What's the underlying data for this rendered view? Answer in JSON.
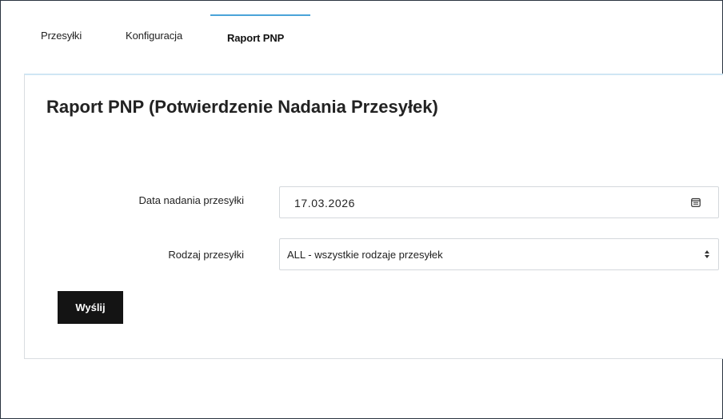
{
  "tabs": [
    {
      "label": "Przesyłki"
    },
    {
      "label": "Konfiguracja"
    },
    {
      "label": "Raport PNP"
    }
  ],
  "active_tab": "Raport PNP",
  "panel": {
    "title": "Raport PNP (Potwierdzenie Nadania Przesyłek)"
  },
  "form": {
    "date_label": "Data nadania przesyłki",
    "date_value": "17.03.2026",
    "type_label": "Rodzaj przesyłki",
    "type_value": "ALL - wszystkie rodzaje przesyłek",
    "submit_label": "Wyślij"
  },
  "icons": {
    "calendar": "calendar-icon",
    "select_arrows": "sort-arrows-icon"
  },
  "colors": {
    "accent": "#4aa3d9",
    "button_bg": "#141414",
    "button_text": "#ffffff"
  }
}
